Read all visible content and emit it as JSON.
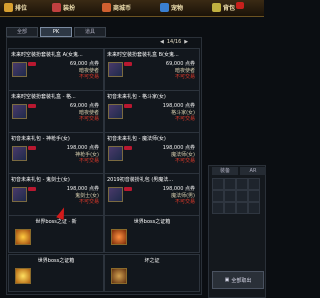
{
  "topbar": {
    "items": [
      {
        "label": "排位",
        "color": "#d8a030"
      },
      {
        "label": "装扮",
        "color": "#c04040"
      },
      {
        "label": "商城币",
        "color": "#d06030"
      },
      {
        "label": "宠物",
        "color": "#3a7fd0"
      },
      {
        "label": "背包",
        "color": "#c0b040"
      }
    ]
  },
  "tabs": [
    "全部",
    "PK",
    "道具"
  ],
  "active_tab": 1,
  "pager": {
    "text": "14/16",
    "prev": "◀",
    "next": "▶"
  },
  "cards": [
    {
      "title": "未来时空装扮套装礼盒 A(女鬼...",
      "price": "69,000 点券",
      "seller": "暗夜使者",
      "note": "不可交易"
    },
    {
      "title": "未来时空装扮套装礼盒 B(女鬼...",
      "price": "69,000 点券",
      "seller": "暗夜使者",
      "note": "不可交易"
    },
    {
      "title": "未来时空装扮套装礼盒 - 格...",
      "price": "69,000 点券",
      "seller": "暗夜使者",
      "note": "不可交易"
    },
    {
      "title": "初音未来礼包 - 格斗家(女)",
      "price": "198,000 点券",
      "seller": "格斗家(女)",
      "note": "不可交易"
    },
    {
      "title": "初音未来礼包 - 神枪手(女)",
      "price": "198,000 点券",
      "seller": "神枪手(女)",
      "note": "不可交易"
    },
    {
      "title": "初音未来礼包 - 魔法师(女)",
      "price": "198,000 点券",
      "seller": "魔法师(女)",
      "note": "不可交易"
    },
    {
      "title": "初音未来礼包 - 鬼剑士(女)",
      "price": "198,000 点券",
      "seller": "鬼剑士(女)",
      "note": "不可交易"
    },
    {
      "title": "2019初音装扮礼包 (男魔法...",
      "price": "198,000 点券",
      "seller": "魔法师(男)",
      "note": "不可交易"
    }
  ],
  "boss_cards": [
    {
      "title": "世界boss之证 · 新"
    },
    {
      "title": "世界boss之证箱"
    },
    {
      "title": "世界boss之证箱"
    },
    {
      "title": "坏之证"
    }
  ],
  "side": {
    "tabs": [
      "装备",
      "AR"
    ],
    "button_label": "全部取出"
  }
}
